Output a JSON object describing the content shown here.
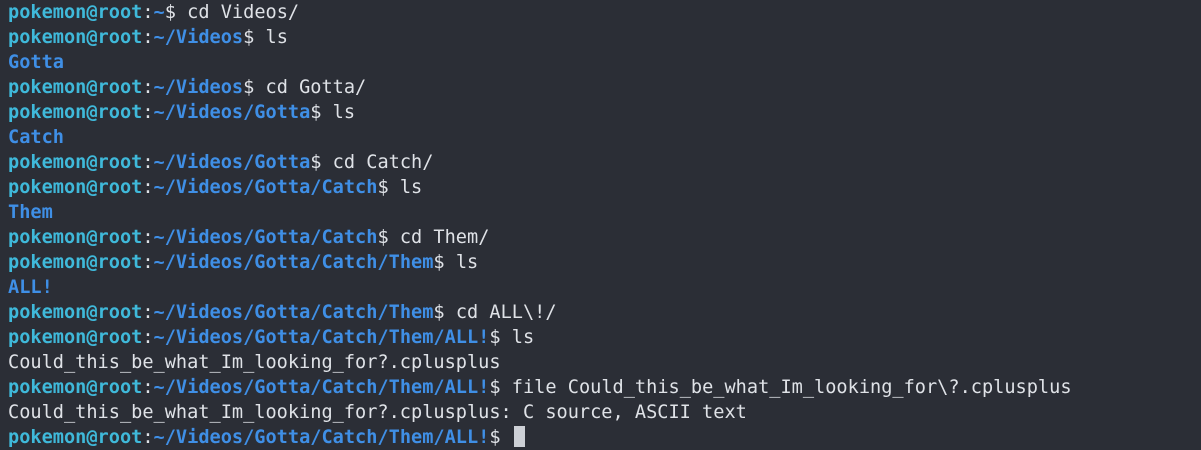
{
  "prompt": {
    "user_host": "pokemon@root",
    "colon": ":",
    "dollar": "$"
  },
  "lines": [
    {
      "type": "cmd",
      "path": "~",
      "command": " cd Videos/"
    },
    {
      "type": "cmd",
      "path": "~/Videos",
      "command": " ls"
    },
    {
      "type": "dir",
      "text": "Gotta"
    },
    {
      "type": "cmd",
      "path": "~/Videos",
      "command": " cd Gotta/"
    },
    {
      "type": "cmd",
      "path": "~/Videos/Gotta",
      "command": " ls"
    },
    {
      "type": "dir",
      "text": "Catch"
    },
    {
      "type": "cmd",
      "path": "~/Videos/Gotta",
      "command": " cd Catch/"
    },
    {
      "type": "cmd",
      "path": "~/Videos/Gotta/Catch",
      "command": " ls"
    },
    {
      "type": "dir",
      "text": "Them"
    },
    {
      "type": "cmd",
      "path": "~/Videos/Gotta/Catch",
      "command": " cd Them/"
    },
    {
      "type": "cmd",
      "path": "~/Videos/Gotta/Catch/Them",
      "command": " ls"
    },
    {
      "type": "dir",
      "text": "ALL!"
    },
    {
      "type": "cmd",
      "path": "~/Videos/Gotta/Catch/Them",
      "command": " cd ALL\\!/"
    },
    {
      "type": "cmd",
      "path": "~/Videos/Gotta/Catch/Them/ALL!",
      "command": " ls"
    },
    {
      "type": "out",
      "text": "Could_this_be_what_Im_looking_for?.cplusplus"
    },
    {
      "type": "cmd",
      "path": "~/Videos/Gotta/Catch/Them/ALL!",
      "command": " file Could_this_be_what_Im_looking_for\\?.cplusplus"
    },
    {
      "type": "out",
      "text": "Could_this_be_what_Im_looking_for?.cplusplus: C source, ASCII text"
    },
    {
      "type": "cmd",
      "path": "~/Videos/Gotta/Catch/Them/ALL!",
      "command": " ",
      "cursor": true
    }
  ],
  "colors": {
    "background": "#2b2e36",
    "prompt_user": "#3fb9da",
    "prompt_path": "#3f8fe6",
    "text": "#dfe2e7"
  }
}
